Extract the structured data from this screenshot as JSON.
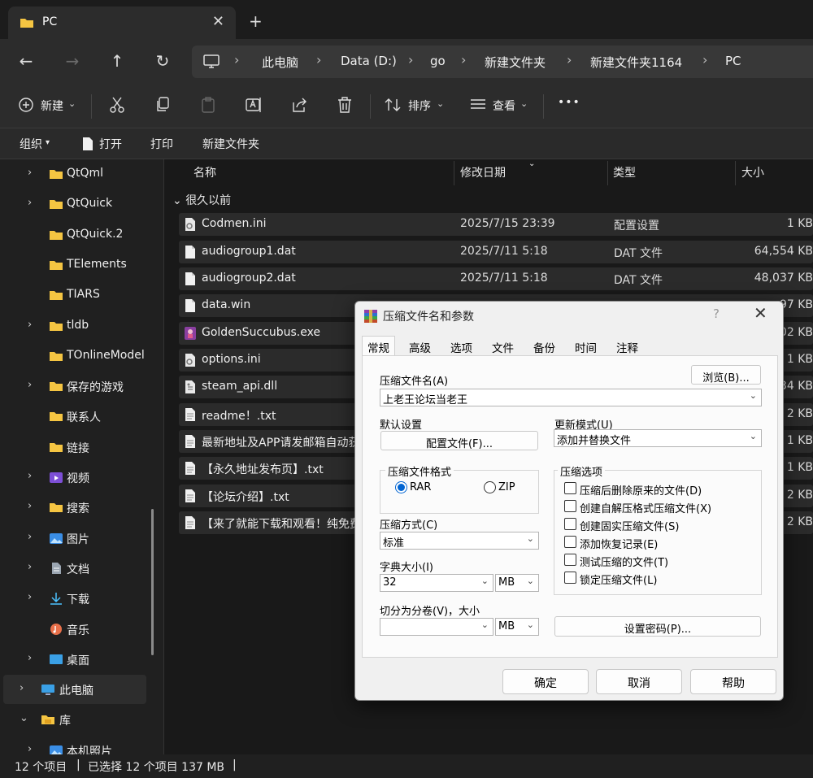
{
  "tab": {
    "label": "PC",
    "close": "✕",
    "new": "+"
  },
  "breadcrumb": [
    "此电脑",
    "Data (D:)",
    "go",
    "新建文件夹",
    "新建文件夹1164",
    "PC"
  ],
  "commandbar": {
    "new": "新建",
    "sort": "排序",
    "view": "查看",
    "more": "•••"
  },
  "subbar": {
    "organize": "组织",
    "open": "打开",
    "print": "打印",
    "new_folder": "新建文件夹"
  },
  "sidebar": {
    "items": [
      {
        "label": "QtQml",
        "chevron": "›",
        "icon": "folder-icon"
      },
      {
        "label": "QtQuick",
        "chevron": "›",
        "icon": "folder-icon"
      },
      {
        "label": "QtQuick.2",
        "chevron": "",
        "icon": "folder-icon"
      },
      {
        "label": "TElements",
        "chevron": "",
        "icon": "folder-icon"
      },
      {
        "label": "TIARS",
        "chevron": "",
        "icon": "folder-icon"
      },
      {
        "label": "tldb",
        "chevron": "›",
        "icon": "folder-icon"
      },
      {
        "label": "TOnlineModel",
        "chevron": "",
        "icon": "folder-icon"
      },
      {
        "label": "保存的游戏",
        "chevron": "›",
        "icon": "folder-icon"
      },
      {
        "label": "联系人",
        "chevron": "",
        "icon": "folder-icon"
      },
      {
        "label": "链接",
        "chevron": "",
        "icon": "folder-icon"
      },
      {
        "label": "视频",
        "chevron": "›",
        "icon": "video-icon"
      },
      {
        "label": "搜索",
        "chevron": "›",
        "icon": "folder-icon"
      },
      {
        "label": "图片",
        "chevron": "›",
        "icon": "picture-icon"
      },
      {
        "label": "文档",
        "chevron": "›",
        "icon": "document-icon"
      },
      {
        "label": "下载",
        "chevron": "›",
        "icon": "download-icon"
      },
      {
        "label": "音乐",
        "chevron": "",
        "icon": "music-icon"
      },
      {
        "label": "桌面",
        "chevron": "›",
        "icon": "desktop-icon"
      },
      {
        "label": "此电脑",
        "chevron": "›",
        "icon": "pc-icon"
      },
      {
        "label": "库",
        "chevron": "⌄",
        "icon": "library-icon"
      },
      {
        "label": "本机照片",
        "chevron": "›",
        "icon": "picture-icon"
      }
    ]
  },
  "columns": {
    "name": "名称",
    "date": "修改日期",
    "type": "类型",
    "size": "大小"
  },
  "group_label": "很久以前",
  "files": [
    {
      "name": "Codmen.ini",
      "date": "2025/7/15 23:39",
      "type": "配置设置",
      "size": "1 KB",
      "icon": "ini-icon"
    },
    {
      "name": "audiogroup1.dat",
      "date": "2025/7/11 5:18",
      "type": "DAT 文件",
      "size": "64,554 KB",
      "icon": "file-icon"
    },
    {
      "name": "audiogroup2.dat",
      "date": "2025/7/11 5:18",
      "type": "DAT 文件",
      "size": "48,037 KB",
      "icon": "file-icon"
    },
    {
      "name": "data.win",
      "date": "",
      "type": "",
      "size": "97 KB",
      "icon": "file-icon"
    },
    {
      "name": "GoldenSuccubus.exe",
      "date": "",
      "type": "",
      "size": "02 KB",
      "icon": "exe-icon"
    },
    {
      "name": "options.ini",
      "date": "",
      "type": "",
      "size": "1 KB",
      "icon": "ini-icon"
    },
    {
      "name": "steam_api.dll",
      "date": "",
      "type": "",
      "size": "34 KB",
      "icon": "dll-icon"
    },
    {
      "name": "readme！.txt",
      "date": "",
      "type": "",
      "size": "2 KB",
      "icon": "txt-icon"
    },
    {
      "name": "最新地址及APP请发邮箱自动获",
      "date": "",
      "type": "",
      "size": "1 KB",
      "icon": "txt-icon"
    },
    {
      "name": "【永久地址发布页】.txt",
      "date": "",
      "type": "",
      "size": "1 KB",
      "icon": "txt-icon"
    },
    {
      "name": "【论坛介绍】.txt",
      "date": "",
      "type": "",
      "size": "2 KB",
      "icon": "txt-icon"
    },
    {
      "name": "【来了就能下载和观看！纯免费",
      "date": "",
      "type": "",
      "size": "2 KB",
      "icon": "txt-icon"
    }
  ],
  "status": {
    "count": "12 个项目",
    "selected": "已选择 12 个项目  137 MB"
  },
  "dialog": {
    "title": "压缩文件名和参数",
    "help": "?",
    "close": "✕",
    "tabs": [
      "常规",
      "高级",
      "选项",
      "文件",
      "备份",
      "时间",
      "注释"
    ],
    "archive_name_label": "压缩文件名(A)",
    "archive_name_value": "上老王论坛当老王",
    "browse": "浏览(B)...",
    "default_settings_label": "默认设置",
    "profiles_button": "配置文件(F)...",
    "update_mode_label": "更新模式(U)",
    "update_mode_value": "添加并替换文件",
    "format_label": "压缩文件格式",
    "format_rar": "RAR",
    "format_zip": "ZIP",
    "format_selected": "RAR",
    "options_label": "压缩选项",
    "options": [
      {
        "label": "压缩后删除原来的文件(D)",
        "checked": false
      },
      {
        "label": "创建自解压格式压缩文件(X)",
        "checked": false
      },
      {
        "label": "创建固实压缩文件(S)",
        "checked": false
      },
      {
        "label": "添加恢复记录(E)",
        "checked": false
      },
      {
        "label": "测试压缩的文件(T)",
        "checked": false
      },
      {
        "label": "锁定压缩文件(L)",
        "checked": false
      }
    ],
    "method_label": "压缩方式(C)",
    "method_value": "标准",
    "dict_label": "字典大小(I)",
    "dict_value": "32",
    "dict_unit": "MB",
    "split_label": "切分为分卷(V)，大小",
    "split_value": "",
    "split_unit": "MB",
    "password_button": "设置密码(P)...",
    "ok": "确定",
    "cancel": "取消",
    "helpbtn": "帮助"
  }
}
